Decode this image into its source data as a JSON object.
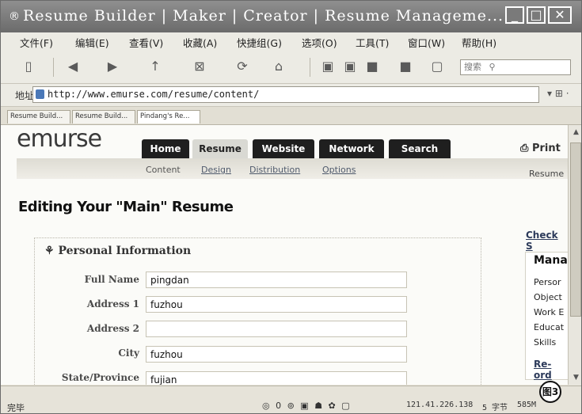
{
  "window": {
    "title": "Resume Builder | Maker | Creator | Resume Manageme...",
    "buttons": {
      "minimize": "_",
      "maximize": "□",
      "close": "✕"
    }
  },
  "menu": [
    "文件(F)",
    "编辑(E)",
    "查看(V)",
    "收藏(A)",
    "快捷组(G)",
    "选项(O)",
    "工具(T)",
    "窗口(W)",
    "帮助(H)"
  ],
  "toolbar": {
    "search_label": "搜索"
  },
  "address": {
    "label": "地址",
    "url": "http://www.emurse.com/resume/content/"
  },
  "tabs": [
    "Resume Build...",
    "Resume Build...",
    "Pindang's Re..."
  ],
  "site": {
    "logo": "emurse",
    "nav": [
      "Home",
      "Resume",
      "Website",
      "Network",
      "Search"
    ],
    "print": "Print",
    "subnav": [
      "Content",
      "Design",
      "Distribution",
      "Options"
    ],
    "resume_right": "Resume",
    "heading": "Editing Your \"Main\" Resume",
    "section_title": "Personal Information",
    "fields": [
      {
        "label": "Full Name",
        "value": "pingdan"
      },
      {
        "label": "Address 1",
        "value": "fuzhou"
      },
      {
        "label": "Address 2",
        "value": ""
      },
      {
        "label": "City",
        "value": "fuzhou"
      },
      {
        "label": "State/Province",
        "value": "fujian"
      }
    ],
    "right": {
      "check": "Check S",
      "mana": "Mana",
      "items": [
        "Persor",
        "Object",
        "Work E",
        "Educat",
        "Skills"
      ],
      "reorder": "Re-ord"
    }
  },
  "status": {
    "left": "完毕",
    "ip": "121.41.226.138",
    "bytes": "5 字节",
    "mem": "585M",
    "badge": "图3"
  }
}
